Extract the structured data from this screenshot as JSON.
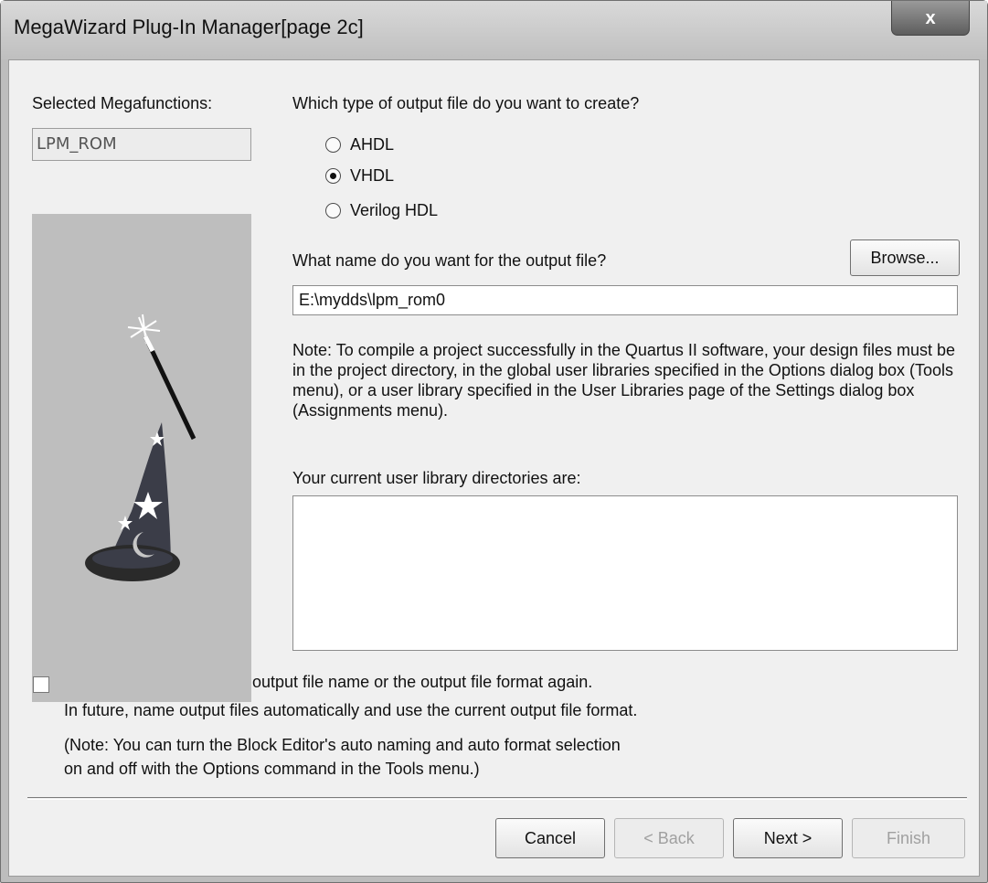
{
  "window": {
    "title": "MegaWizard Plug-In Manager[page 2c]",
    "close_label": "x"
  },
  "left": {
    "selected_label": "Selected Megafunctions:",
    "selected_value": "LPM_ROM"
  },
  "output_type": {
    "question": "Which type of output file do you want to create?",
    "options": [
      {
        "label": "AHDL",
        "selected": false
      },
      {
        "label": "VHDL",
        "selected": true
      },
      {
        "label": "Verilog HDL",
        "selected": false
      }
    ]
  },
  "output_name": {
    "question": "What name do you want for the output file?",
    "browse_label": "Browse...",
    "value": "E:\\mydds\\lpm_rom0"
  },
  "note_text": "Note: To compile a project successfully in the Quartus II software, your design files must be in the project directory, in the global user libraries specified in the Options dialog box (Tools menu), or a user library specified in the User Libraries page of the Settings dialog box (Assignments menu).",
  "user_libs": {
    "label": "Your current user library directories are:",
    "items": []
  },
  "auto_name": {
    "line1": "output file name or the output file format again.",
    "line2": "In future, name output files automatically and use the current output file format.",
    "note1": "(Note: You can turn the Block Editor's auto naming and auto format selection",
    "note2": "on and off with the Options command in the Tools menu.)",
    "checked": false
  },
  "buttons": {
    "cancel": "Cancel",
    "back": "< Back",
    "next": "Next >",
    "finish": "Finish"
  }
}
